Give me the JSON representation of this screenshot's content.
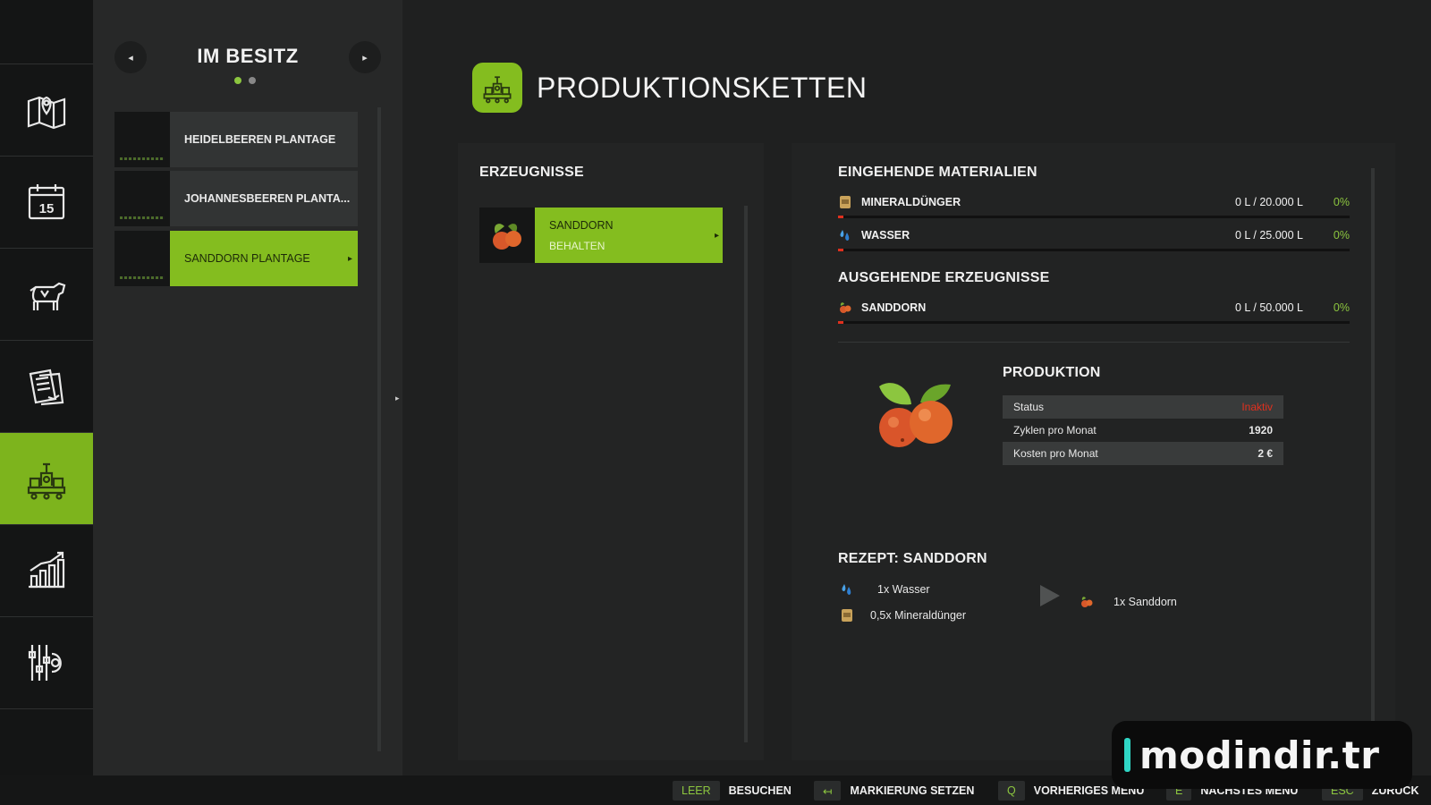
{
  "sidebar": {
    "items": [
      {
        "icon": "map-pin-icon"
      },
      {
        "icon": "calendar-icon",
        "day": "15"
      },
      {
        "icon": "cow-icon"
      },
      {
        "icon": "contracts-icon"
      },
      {
        "icon": "production-icon",
        "active": true
      },
      {
        "icon": "statistics-icon"
      },
      {
        "icon": "settings-icon"
      }
    ]
  },
  "list": {
    "title": "IM BESITZ",
    "prev_glyph": "◂",
    "next_glyph": "▸",
    "items": [
      {
        "label": "HEIDELBEEREN PLANTAGE"
      },
      {
        "label": "JOHANNESBEEREN PLANTA..."
      },
      {
        "label": "SANDDORN PLANTAGE",
        "active": true
      }
    ]
  },
  "collapse_glyph": "▸",
  "main": {
    "title": "PRODUKTIONSKETTEN"
  },
  "products": {
    "title": "ERZEUGNISSE",
    "items": [
      {
        "name": "SANDDORN",
        "mode": "BEHALTEN"
      }
    ]
  },
  "incoming": {
    "title": "EINGEHENDE MATERIALIEN",
    "rows": [
      {
        "name": "MINERALDÜNGER",
        "amount": "0 L / 20.000 L",
        "percent": "0%",
        "fill": 0
      },
      {
        "name": "WASSER",
        "amount": "0 L / 25.000 L",
        "percent": "0%",
        "fill": 0
      }
    ]
  },
  "outgoing": {
    "title": "AUSGEHENDE ERZEUGNISSE",
    "rows": [
      {
        "name": "SANDDORN",
        "amount": "0 L / 50.000 L",
        "percent": "0%",
        "fill": 0
      }
    ]
  },
  "production": {
    "title": "PRODUKTION",
    "rows": [
      {
        "label": "Status",
        "value": "Inaktiv"
      },
      {
        "label": "Zyklen pro Monat",
        "value": "1920"
      },
      {
        "label": "Kosten pro Monat",
        "value": "2 €"
      }
    ]
  },
  "recipe": {
    "title": "REZEPT: SANDDORN",
    "inputs": [
      "1x Wasser",
      "0,5x Mineraldünger"
    ],
    "output": "1x Sanddorn"
  },
  "bottom_bar": [
    {
      "key": "LEER",
      "label": "BESUCHEN"
    },
    {
      "key": "↤",
      "label": "MARKIERUNG SETZEN"
    },
    {
      "key": "Q",
      "label": "VORHERIGES MENÜ"
    },
    {
      "key": "E",
      "label": "NÄCHSTES MENÜ"
    },
    {
      "key": "ESC",
      "label": "ZURÜCK"
    }
  ],
  "watermark": "modindir.tr",
  "colors": {
    "accent": "#84bd1f",
    "inactive_red": "#e0301e",
    "percent_green": "#8cc63f"
  }
}
